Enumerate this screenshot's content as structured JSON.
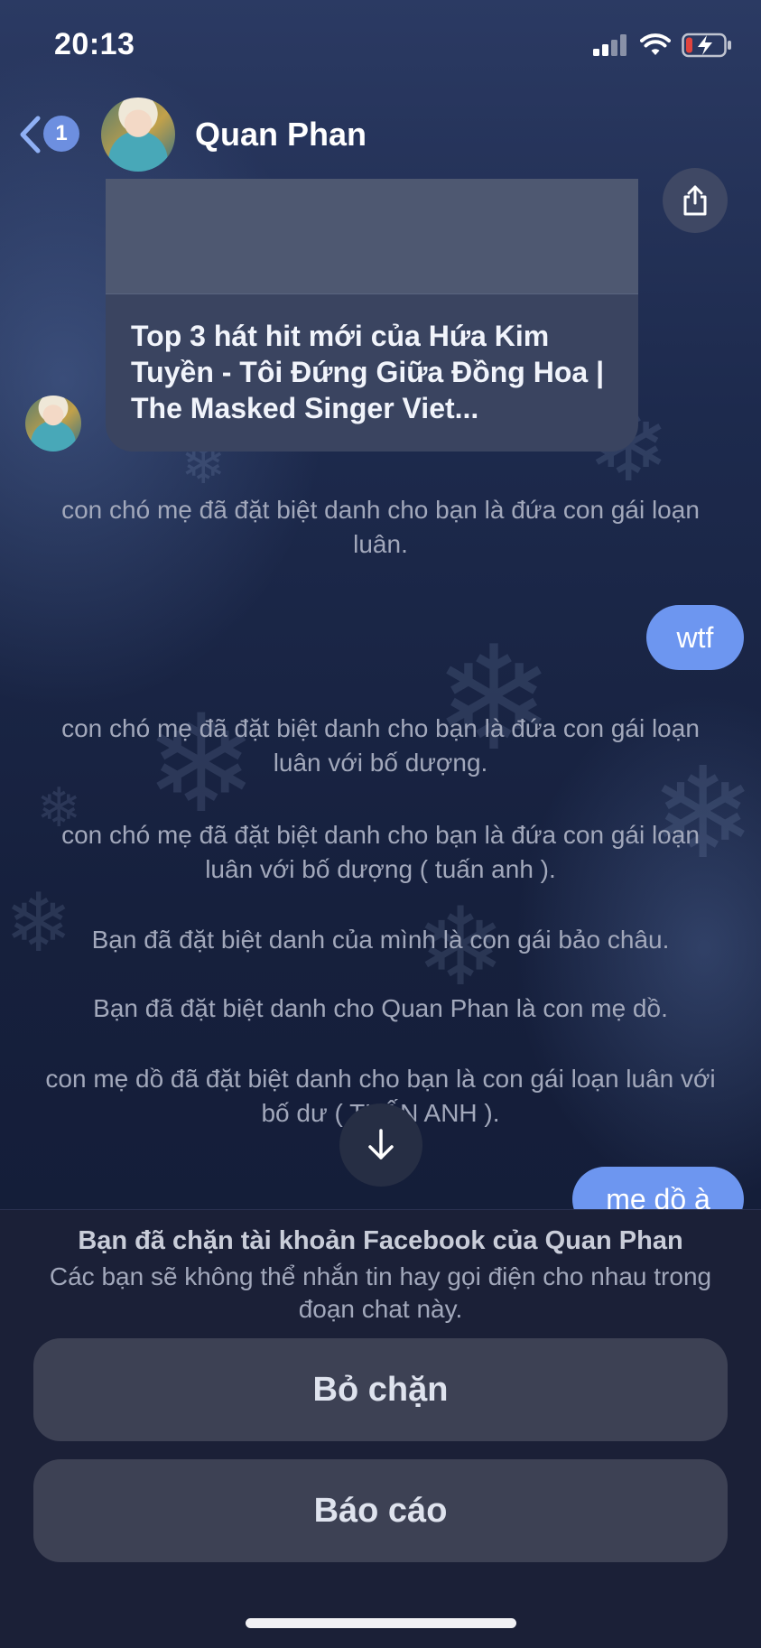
{
  "status_bar": {
    "time": "20:13",
    "icons": [
      "signal-icon",
      "wifi-icon",
      "battery-charging-icon"
    ],
    "battery_color": "#e0443e"
  },
  "header": {
    "back_badge": "1",
    "contact_name": "Quan Phan",
    "icons": [
      "chevron-left-icon",
      "avatar"
    ]
  },
  "messages": {
    "link_card": {
      "title": "Top 3 hát hit mới của Hứa Kim Tuyền - Tôi Đứng Giữa Đồng Hoa | The Masked Singer Viet...",
      "share_icon": "share-icon"
    },
    "notice_1": "con chó mẹ đã đặt biệt danh cho bạn là đứa con gái loạn luân.",
    "bubble_1": "wtf",
    "notice_2": "con chó mẹ đã đặt biệt danh cho bạn là đứa con gái loạn luân với bố dượng.",
    "notice_3": "con chó mẹ đã đặt biệt danh cho bạn là đứa con gái loạn luân với bố dượng ( tuấn anh ).",
    "notice_4": "Bạn đã đặt biệt danh của mình là con gái bảo châu.",
    "notice_5": "Bạn đã đặt biệt danh cho Quan Phan là con mẹ dồ.",
    "notice_6": "con mẹ dồ đã đặt biệt danh cho bạn là con gái loạn luân với bố dư     ( TUẤN ANH ).",
    "bubble_2": "mẹ dồ à"
  },
  "block_sheet": {
    "title": "Bạn đã chặn tài khoản Facebook của Quan Phan",
    "subtitle": "Các bạn sẽ không thể nhắn tin hay gọi điện cho nhau trong đoạn chat này.",
    "unblock_label": "Bỏ chặn",
    "report_label": "Báo cáo"
  },
  "colors": {
    "accent_bubble": "#6d96f0",
    "badge": "#6d8fe0",
    "sheet_background": "#1b2037",
    "button_background": "#3d4154"
  }
}
